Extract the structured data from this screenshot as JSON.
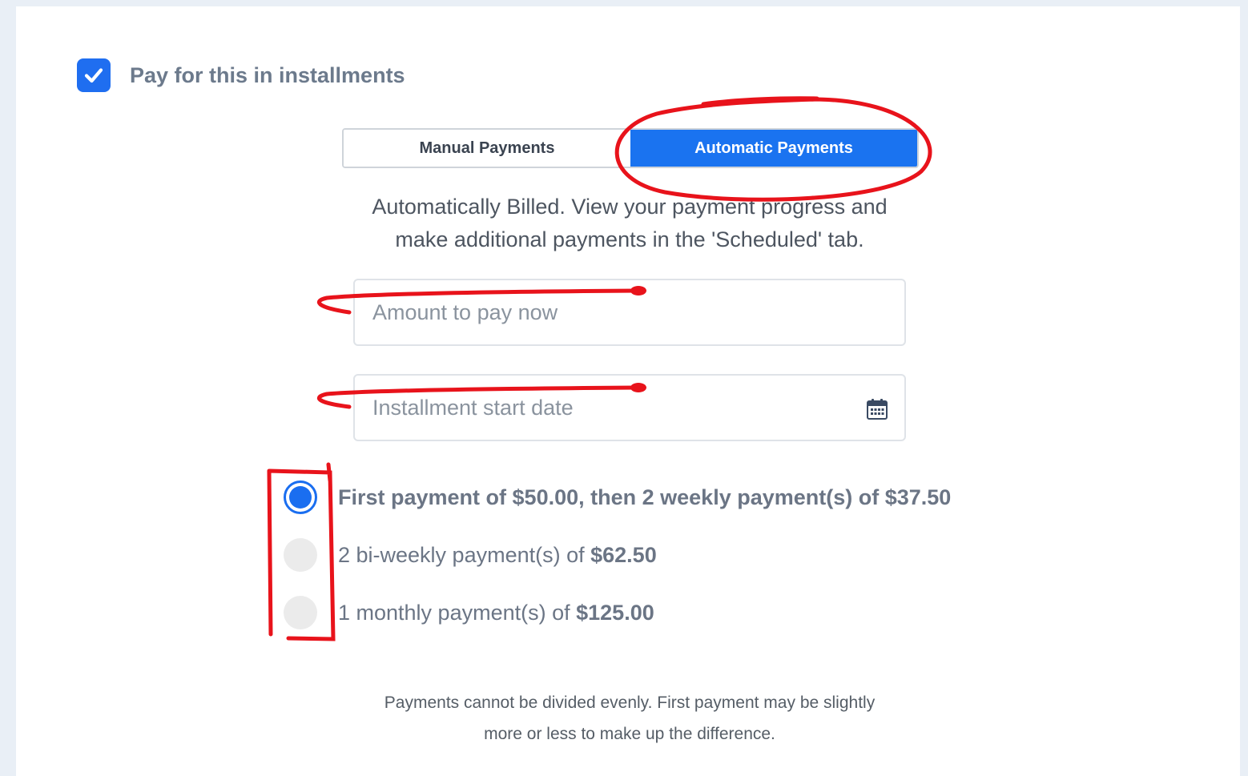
{
  "installments": {
    "checked": true,
    "label": "Pay for this in installments"
  },
  "payment_mode": {
    "manual_label": "Manual Payments",
    "automatic_label": "Automatic Payments",
    "selected": "automatic"
  },
  "description": {
    "line1": "Automatically Billed. View your payment progress and",
    "line2": "make additional payments in the 'Scheduled' tab."
  },
  "amount_field": {
    "placeholder": "Amount to pay now",
    "value": ""
  },
  "start_date_field": {
    "placeholder": "Installment start date",
    "value": "",
    "icon": "calendar-icon"
  },
  "options": [
    {
      "selected": true,
      "part1": "First payment of ",
      "amount1": "$50.00",
      "part2": ", then 2 weekly payment(s) of ",
      "amount2": "$37.50"
    },
    {
      "selected": false,
      "part1": "2 bi-weekly payment(s) of ",
      "amount1": "$62.50"
    },
    {
      "selected": false,
      "part1": "1 monthly payment(s) of ",
      "amount1": "$125.00"
    }
  ],
  "footnote": {
    "line1": "Payments cannot be divided evenly. First payment may be slightly",
    "line2": "more or less to make up the difference."
  },
  "colors": {
    "accent": "#1a73f0",
    "annotation": "#e8131b",
    "background": "#e9eff6"
  }
}
